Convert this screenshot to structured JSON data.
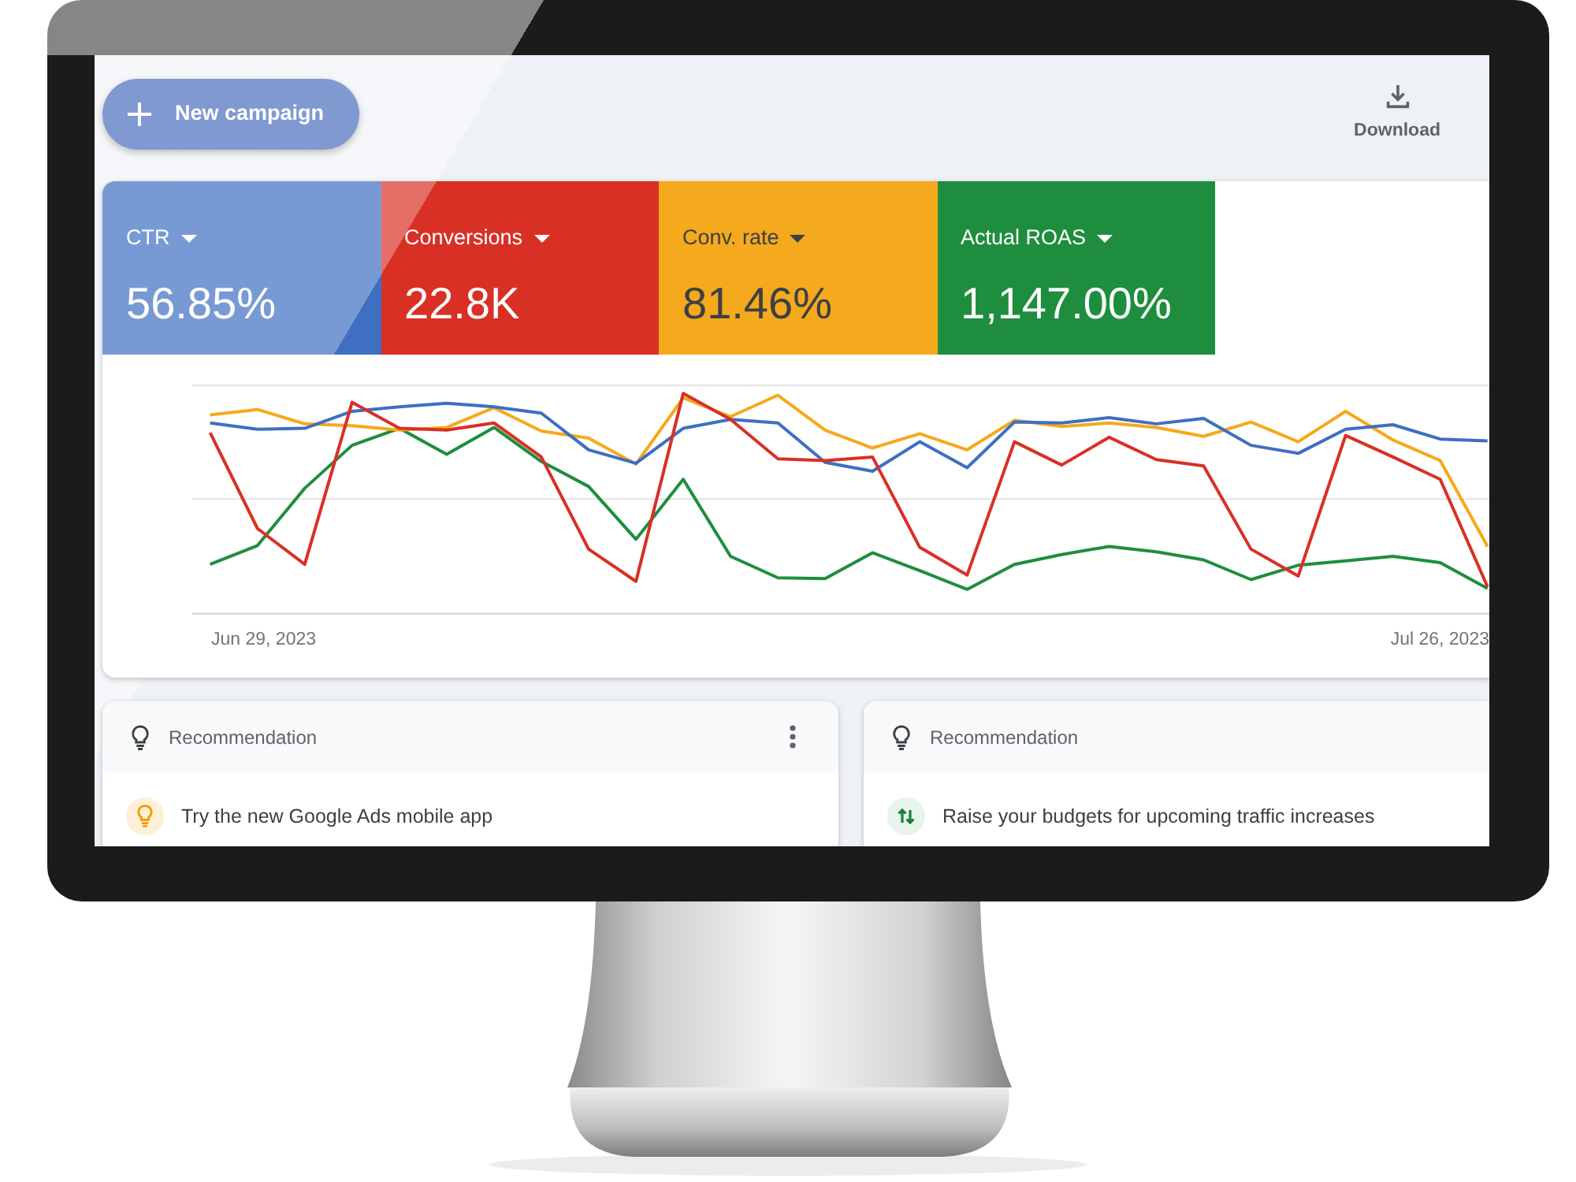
{
  "toolbar": {
    "new_campaign": {
      "label": "New campaign"
    },
    "download": {
      "label": "Download"
    }
  },
  "metrics": [
    {
      "label": "CTR",
      "value": "56.85%",
      "color": "#3e6fc1"
    },
    {
      "label": "Conversions",
      "value": "22.8K",
      "color": "#d93025"
    },
    {
      "label": "Conv. rate",
      "value": "81.46%",
      "color": "#f5a91c"
    },
    {
      "label": "Actual ROAS",
      "value": "1,147.00%",
      "color": "#1e8e3e"
    }
  ],
  "chart": {
    "x_labels": [
      "Jun 29, 2023",
      "Jul 26, 2023"
    ]
  },
  "recommendations": [
    {
      "heading": "Recommendation",
      "text": "Try the new Google Ads mobile app",
      "kind": "idea",
      "menu": true
    },
    {
      "heading": "Recommendation",
      "text": "Raise your budgets for upcoming traffic increases",
      "kind": "budget",
      "menu": false
    }
  ]
}
